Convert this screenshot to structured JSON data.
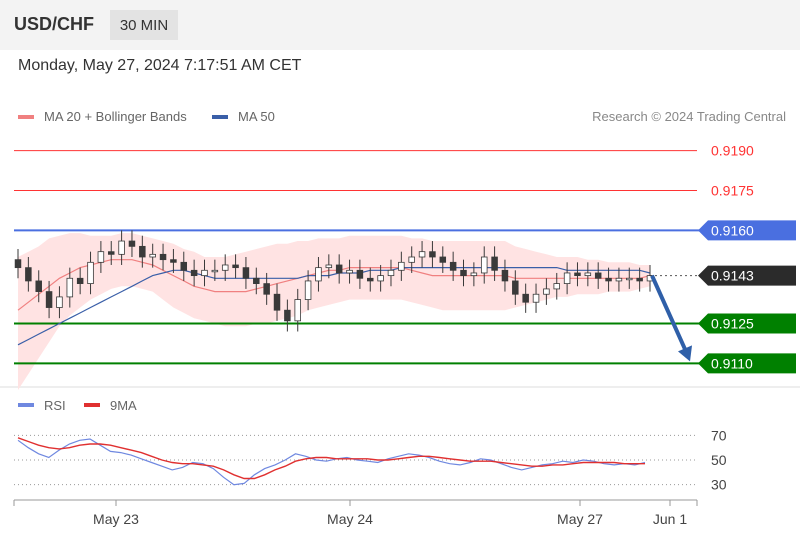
{
  "header": {
    "symbol": "USD/CHF",
    "timeframe": "30 MIN",
    "datetime": "Monday, May 27, 2024 7:17:51 AM CET"
  },
  "legend": {
    "ma20": "MA 20 + Bollinger Bands",
    "ma50": "MA 50",
    "credit": "Research © 2024 Trading Central",
    "rsi": "RSI",
    "rsi_ma": "9MA"
  },
  "colors": {
    "ma20": "#f08080",
    "ma50": "#3a5fa8",
    "resistance": "#ff3333",
    "pivot": "#4a6fe0",
    "support": "#008000",
    "bollinger_fill": "#ffe3e3",
    "candle": "#3a3a3a",
    "rsi": "#6f88e0",
    "rsi_ma": "#e03030",
    "forecast_arrow": "#2f5fa8"
  },
  "chart_data": [
    {
      "type": "line",
      "title": "",
      "price_axis": {
        "ylim": [
          0.91,
          0.92
        ]
      },
      "x_ticks": [
        "May 23",
        "May 24",
        "May 27",
        "Jun 1"
      ],
      "levels": [
        {
          "value": 0.919,
          "label": "0.9190",
          "kind": "resistance"
        },
        {
          "value": 0.9175,
          "label": "0.9175",
          "kind": "resistance"
        },
        {
          "value": 0.916,
          "label": "0.9160",
          "kind": "pivot"
        },
        {
          "value": 0.9143,
          "label": "0.9143",
          "kind": "last"
        },
        {
          "value": 0.9125,
          "label": "0.9125",
          "kind": "support"
        },
        {
          "value": 0.911,
          "label": "0.9110",
          "kind": "support"
        }
      ],
      "price_series": {
        "name": "USD/CHF",
        "values": [
          0.9146,
          0.9141,
          0.9137,
          0.9131,
          0.9135,
          0.9142,
          0.914,
          0.9148,
          0.9152,
          0.9151,
          0.9156,
          0.9154,
          0.915,
          0.9151,
          0.9149,
          0.9148,
          0.9145,
          0.9143,
          0.9145,
          0.9145,
          0.9147,
          0.9146,
          0.9142,
          0.914,
          0.9136,
          0.913,
          0.9126,
          0.9134,
          0.9141,
          0.9146,
          0.9147,
          0.9144,
          0.9145,
          0.9142,
          0.9141,
          0.9143,
          0.9145,
          0.9148,
          0.915,
          0.9152,
          0.915,
          0.9148,
          0.9145,
          0.9143,
          0.9144,
          0.915,
          0.9145,
          0.9141,
          0.9136,
          0.9133,
          0.9136,
          0.9138,
          0.914,
          0.9144,
          0.9143,
          0.9144,
          0.9142,
          0.9141,
          0.9142,
          0.9142,
          0.9141,
          0.9143
        ]
      },
      "ma20": [
        0.913,
        0.9133,
        0.9136,
        0.9139,
        0.9142,
        0.9144,
        0.9146,
        0.9147,
        0.9148,
        0.9149,
        0.9149,
        0.9149,
        0.9148,
        0.9147,
        0.9145,
        0.9143,
        0.9141,
        0.9139,
        0.9138,
        0.9137,
        0.9137,
        0.9137,
        0.9137,
        0.9138,
        0.9139,
        0.914,
        0.9141,
        0.9142,
        0.9143,
        0.9144,
        0.9145,
        0.9145,
        0.9146,
        0.9146,
        0.9146,
        0.9146,
        0.9146,
        0.9146,
        0.9145,
        0.9144,
        0.9143,
        0.9143,
        0.9143,
        0.9143,
        0.9143,
        0.9143,
        0.9143,
        0.9143,
        0.9142,
        0.9142,
        0.9142,
        0.9142,
        0.9142,
        0.9142,
        0.9142,
        0.9142,
        0.9142,
        0.9142,
        0.9142,
        0.9142,
        0.9142,
        0.9143
      ],
      "ma50": [
        0.9117,
        0.9119,
        0.9121,
        0.9123,
        0.9125,
        0.9127,
        0.9129,
        0.9131,
        0.9133,
        0.9135,
        0.9137,
        0.9139,
        0.9141,
        0.9143,
        0.9144,
        0.9145,
        0.9145,
        0.9144,
        0.9143,
        0.9142,
        0.9142,
        0.9142,
        0.9142,
        0.9142,
        0.9142,
        0.9142,
        0.9142,
        0.9142,
        0.9143,
        0.9143,
        0.9143,
        0.9144,
        0.9144,
        0.9144,
        0.9145,
        0.9145,
        0.9145,
        0.9146,
        0.9146,
        0.9146,
        0.9146,
        0.9146,
        0.9146,
        0.9146,
        0.9146,
        0.9146,
        0.9146,
        0.9146,
        0.9146,
        0.9146,
        0.9146,
        0.9146,
        0.9146,
        0.9145,
        0.9145,
        0.9145,
        0.9145,
        0.9145,
        0.9145,
        0.9145,
        0.9145,
        0.9144
      ],
      "bollinger_upper": [
        0.915,
        0.9152,
        0.9154,
        0.9157,
        0.9158,
        0.9159,
        0.9159,
        0.9158,
        0.9158,
        0.9158,
        0.9159,
        0.9159,
        0.9158,
        0.9157,
        0.9156,
        0.9155,
        0.9153,
        0.9152,
        0.915,
        0.915,
        0.915,
        0.9151,
        0.9152,
        0.9153,
        0.9154,
        0.9155,
        0.9155,
        0.9156,
        0.9156,
        0.9157,
        0.9157,
        0.9157,
        0.9158,
        0.9158,
        0.9158,
        0.9158,
        0.9158,
        0.9158,
        0.9157,
        0.9157,
        0.9156,
        0.9156,
        0.9156,
        0.9156,
        0.9156,
        0.9156,
        0.9156,
        0.9156,
        0.9154,
        0.9153,
        0.9152,
        0.9151,
        0.915,
        0.915,
        0.915,
        0.9149,
        0.9149,
        0.9148,
        0.9148,
        0.9148,
        0.9147,
        0.9147
      ],
      "bollinger_lower": [
        0.91,
        0.9106,
        0.9112,
        0.9118,
        0.9124,
        0.9128,
        0.9131,
        0.9134,
        0.9136,
        0.9138,
        0.9139,
        0.9139,
        0.9138,
        0.9137,
        0.9134,
        0.9131,
        0.9129,
        0.9127,
        0.9126,
        0.9125,
        0.9124,
        0.9124,
        0.9124,
        0.9125,
        0.9125,
        0.9126,
        0.9127,
        0.9128,
        0.913,
        0.9131,
        0.9132,
        0.9133,
        0.9134,
        0.9134,
        0.9134,
        0.9134,
        0.9134,
        0.9134,
        0.9133,
        0.9132,
        0.9131,
        0.913,
        0.913,
        0.913,
        0.913,
        0.913,
        0.913,
        0.913,
        0.9131,
        0.9132,
        0.9133,
        0.9134,
        0.9135,
        0.9135,
        0.9136,
        0.9136,
        0.9136,
        0.9137,
        0.9137,
        0.9137,
        0.9138,
        0.9139
      ],
      "forecast_target": 0.911
    },
    {
      "type": "line",
      "title": "",
      "ylim": [
        20,
        80
      ],
      "y_ticks": [
        70,
        50,
        30
      ],
      "x_ticks": [
        "May 23",
        "May 24",
        "May 27",
        "Jun 1"
      ],
      "series": [
        {
          "name": "RSI",
          "values": [
            66,
            60,
            55,
            52,
            58,
            63,
            66,
            67,
            62,
            57,
            56,
            54,
            51,
            48,
            45,
            42,
            44,
            48,
            47,
            43,
            36,
            30,
            31,
            38,
            43,
            46,
            50,
            55,
            53,
            50,
            49,
            51,
            52,
            50,
            49,
            48,
            51,
            53,
            55,
            54,
            52,
            49,
            47,
            46,
            48,
            51,
            50,
            47,
            44,
            42,
            44,
            46,
            47,
            49,
            48,
            50,
            49,
            47,
            46,
            47,
            46,
            48
          ]
        },
        {
          "name": "9MA",
          "values": [
            68,
            65,
            62,
            60,
            59,
            60,
            62,
            63,
            63,
            62,
            60,
            58,
            56,
            53,
            50,
            48,
            47,
            47,
            46,
            45,
            42,
            38,
            35,
            35,
            38,
            42,
            45,
            49,
            51,
            52,
            52,
            51,
            51,
            51,
            51,
            50,
            50,
            51,
            52,
            53,
            53,
            52,
            51,
            50,
            49,
            49,
            49,
            48,
            47,
            46,
            45,
            45,
            46,
            46,
            47,
            48,
            48,
            48,
            48,
            47,
            47,
            47
          ]
        }
      ]
    }
  ]
}
